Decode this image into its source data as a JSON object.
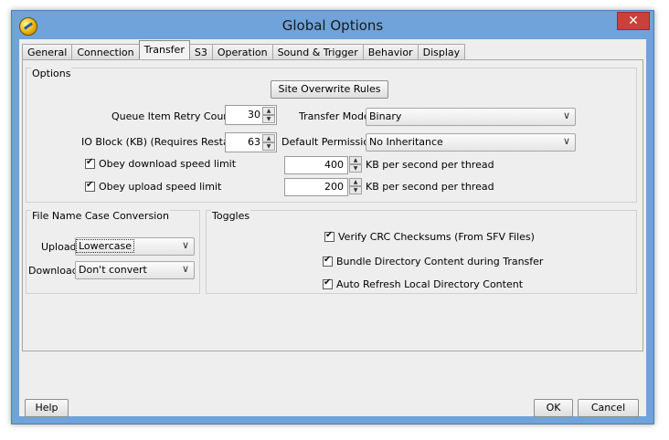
{
  "window": {
    "title": "Global Options",
    "close_label": "✕"
  },
  "tabs": [
    "General",
    "Connection",
    "Transfer",
    "S3",
    "Operation",
    "Sound & Trigger",
    "Behavior",
    "Display"
  ],
  "options": {
    "title": "Options",
    "overwrite_button": "Site Overwrite Rules",
    "retry_label": "Queue Item Retry Count",
    "retry_value": "30",
    "io_label": "IO Block (KB) (Requires Restart)",
    "io_value": "63",
    "transfer_mode_label": "Transfer Mode",
    "transfer_mode_value": "Binary",
    "permission_label": "Default Permission",
    "permission_value": "No Inheritance",
    "download_limit_label": "Obey download speed limit",
    "download_limit_checked": true,
    "download_limit_value": "400",
    "upload_limit_label": "Obey upload speed limit",
    "upload_limit_checked": true,
    "upload_limit_value": "200",
    "unit_label": "KB per second per thread"
  },
  "case_conversion": {
    "title": "File Name Case Conversion",
    "upload_label": "Upload",
    "upload_value": "Lowercase",
    "download_label": "Download",
    "download_value": "Don't convert"
  },
  "toggles": {
    "title": "Toggles",
    "items": [
      {
        "label": "Verify CRC Checksums (From SFV Files)",
        "checked": true
      },
      {
        "label": "Bundle Directory Content during Transfer",
        "checked": true
      },
      {
        "label": "Auto Refresh Local Directory Content",
        "checked": true
      }
    ]
  },
  "footer": {
    "help": "Help",
    "ok": "OK",
    "cancel": "Cancel"
  },
  "icons": {
    "app": "app-logo-icon",
    "close": "close-icon",
    "dropdown": "chevron-down-icon",
    "spin_up": "arrow-up-icon",
    "spin_down": "arrow-down-icon",
    "check": "checkmark-icon"
  },
  "colors": {
    "titlebar": "#6fa3d9",
    "close": "#c9413a",
    "client": "#eeeeee"
  }
}
